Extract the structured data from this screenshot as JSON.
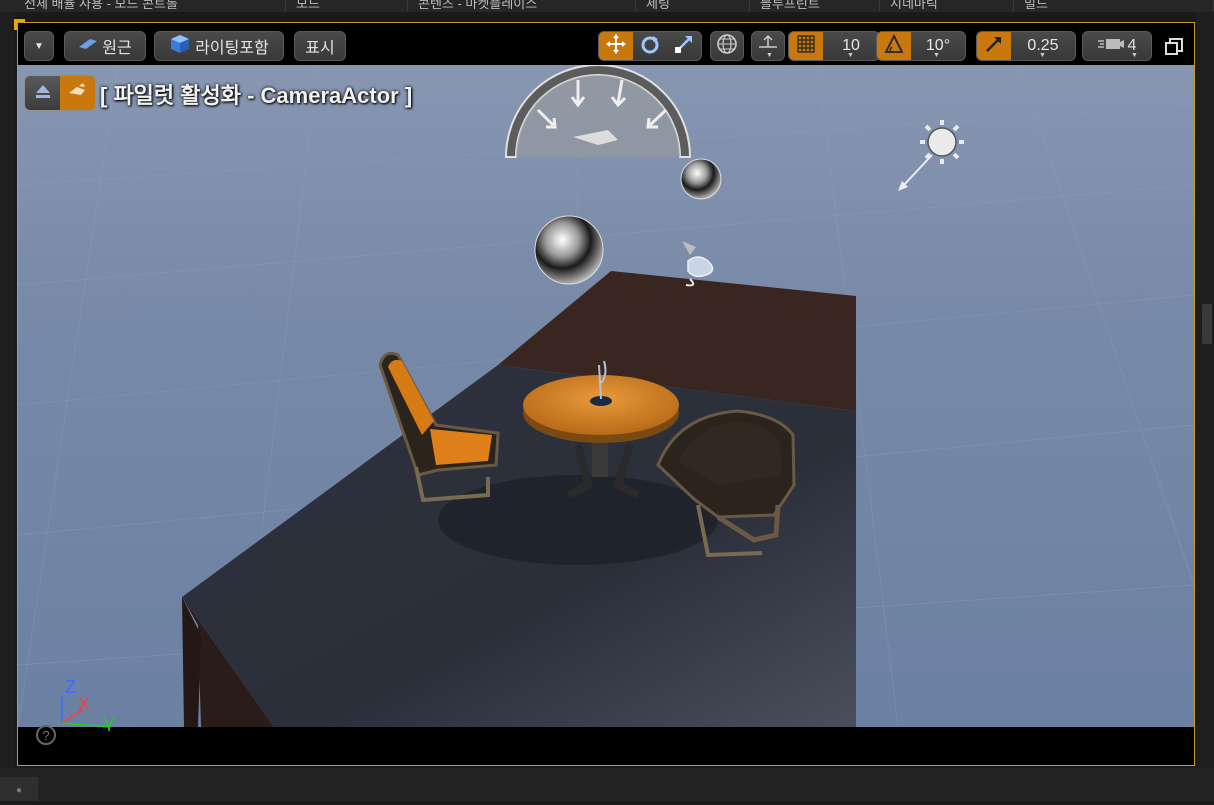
{
  "menu_strip": {
    "cells": [
      "전체 배율 사용 - 모드 콘트롤",
      "모드",
      "콘텐츠 - 마켓플레이스",
      "세팅",
      "블루프린트",
      "시네마틱",
      "빌드"
    ]
  },
  "toolbar": {
    "dropdown_icon": "chevron-down-icon",
    "perspective_label": "원근",
    "lighting_label": "라이팅포함",
    "show_label": "표시",
    "grid_snap_value": "10",
    "rotation_snap_value": "10°",
    "scale_snap_value": "0.25",
    "camera_speed_value": "4"
  },
  "pilot": {
    "label": "[ 파일럿 활성화 - CameraActor ]"
  },
  "axis": {
    "z": "Z",
    "x": "X",
    "y": "Y"
  },
  "colors": {
    "accent": "#c8780c",
    "viewport_border": "#c89b2c",
    "sky": "#7789a8"
  }
}
